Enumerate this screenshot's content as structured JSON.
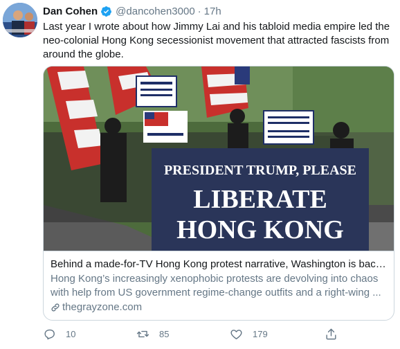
{
  "tweet": {
    "display_name": "Dan Cohen",
    "handle": "@dancohen3000",
    "separator": "·",
    "time": "17h",
    "text": "Last year I wrote about how Jimmy Lai and his tabloid media empire led the neo-colonial Hong Kong secessionist movement that attracted fascists from around the globe."
  },
  "card": {
    "image_banner_line1": "PRESIDENT TRUMP, PLEASE",
    "image_banner_line2": "LIBERATE",
    "image_banner_line3": "HONG KONG",
    "title": "Behind a made-for-TV Hong Kong protest narrative, Washington is back...",
    "description": "Hong Kong’s increasingly xenophobic protests are devolving into chaos with help from US government regime-change outfits and a right-wing ...",
    "domain": "thegrayzone.com"
  },
  "actions": {
    "reply_count": "10",
    "retweet_count": "85",
    "like_count": "179"
  },
  "icons": {
    "verified": "verified-badge-icon",
    "link": "link-icon",
    "reply": "reply-icon",
    "retweet": "retweet-icon",
    "like": "heart-icon",
    "share": "share-icon"
  },
  "colors": {
    "verified": "#1da1f2",
    "muted_text": "#657786",
    "border": "#ccd6dd",
    "banner": "#2a3559"
  }
}
